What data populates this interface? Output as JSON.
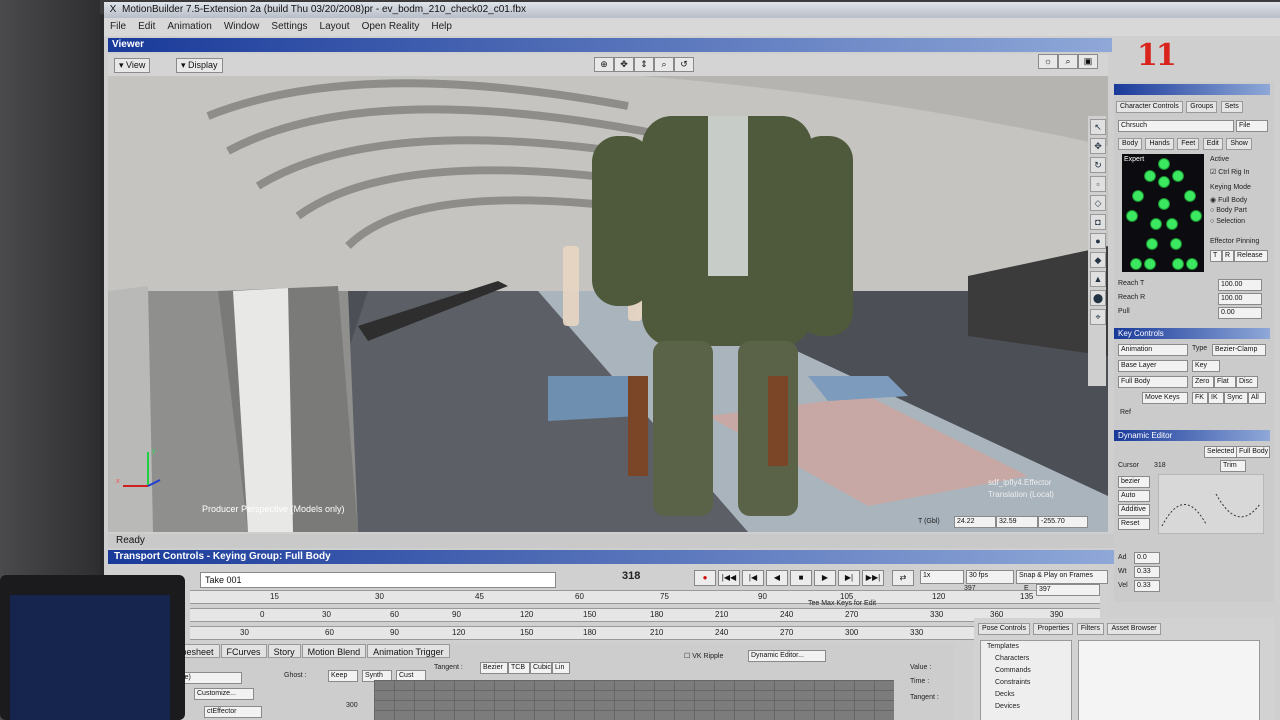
{
  "window": {
    "title": "MotionBuilder 7.5-Extension 2a  (build Thu 03/20/2008)pr  -  ev_bodm_210_check02_c01.fbx",
    "close_glyph": "X"
  },
  "menu": [
    "File",
    "Edit",
    "Animation",
    "Window",
    "Settings",
    "Layout",
    "Open Reality",
    "Help"
  ],
  "viewer": {
    "title": "Viewer",
    "view_label": "View",
    "display_label": "Display",
    "camera_label": "Producer Perspective (Models only)",
    "effector_label": "sdf_lpfly4.Effector",
    "translation_label": "Translation (Local)",
    "status": "Ready",
    "coords": {
      "t_label": "T (Gbl)",
      "x": "24.22",
      "y": "32.59",
      "z": "-255.70"
    },
    "axis_x": "x",
    "axis_y": "y"
  },
  "transport": {
    "title": "Transport Controls  -  Keying Group: Full Body",
    "take": "Take 001",
    "frame_counter": "318",
    "fps": "30 fps",
    "snap": "Snap & Play on Frames",
    "speed": "1x",
    "end_frame": "397",
    "end_label": "E",
    "end_value": "397",
    "ruler_top": [
      "15",
      "30",
      "45",
      "60",
      "75",
      "90",
      "105",
      "120",
      "135"
    ],
    "ruler_mid": [
      "0",
      "30",
      "60",
      "90",
      "120",
      "150",
      "180",
      "210",
      "240",
      "270",
      "330",
      "360",
      "390"
    ],
    "ruler_bottom": [
      "30",
      "60",
      "90",
      "120",
      "150",
      "180",
      "210",
      "240",
      "270",
      "300",
      "330",
      "360",
      "390"
    ],
    "hint": "Tee Max Keys for Edit"
  },
  "character_controls": {
    "tabs": [
      "Character Controls",
      "Groups",
      "Sets"
    ],
    "character": "Chrsuch",
    "file_label": "File",
    "body_tabs": [
      "Body",
      "Hands",
      "Feet"
    ],
    "edit_label": "Edit",
    "show_label": "Show",
    "expert_label": "Expert",
    "active_label": "Active",
    "ctrl_rig_label": "Ctrl Rig In",
    "keying_mode_label": "Keying Mode",
    "keying_modes": [
      "Full Body",
      "Body Part",
      "Selection"
    ],
    "effector_pinning": "Effector Pinning",
    "pin_t": "T",
    "pin_r": "R",
    "release_label": "Release",
    "reach_t_label": "Reach T",
    "reach_t_value": "100.00",
    "reach_r_label": "Reach R",
    "reach_r_value": "100.00",
    "pull_label": "Pull",
    "pull_value": "0.00"
  },
  "key_controls": {
    "title": "Key Controls",
    "mode": "Animation",
    "type_label": "Type",
    "type_value": "Bezier-Clamp",
    "layer": "Base Layer",
    "key_label": "Key",
    "body": "Full Body",
    "zero": "Zero",
    "flat": "Flat",
    "disc": "Disc",
    "move_keys": "Move Keys",
    "fk": "FK",
    "ik": "IK",
    "sync": "Sync",
    "all": "All",
    "ref_label": "Ref"
  },
  "dynamic_editor": {
    "title": "Dynamic Editor",
    "selected": "Selected",
    "full_body": "Full Body",
    "cursor_label": "Cursor",
    "cursor_value": "318",
    "trim": "Trim",
    "curve": "bezier",
    "mode": "Auto",
    "additive": "Additive",
    "reset": "Reset",
    "rows": [
      {
        "label": "Ad",
        "value": "0.0"
      },
      {
        "label": "Wt",
        "value": "0.33"
      },
      {
        "label": "Vel",
        "value": "0.33"
      }
    ]
  },
  "bottom": {
    "tabs": [
      "Dopesheet",
      "FCurves",
      "Story",
      "Motion Blend",
      "Animation Trigger"
    ],
    "type_label": "(Type)",
    "customize": "Customize...",
    "effector": "ctEffector",
    "ghost_label": "Ghost :",
    "keep": "Keep",
    "sync": "Synth",
    "cust": "Cust",
    "tangent_label": "Tangent :",
    "tangent_opts": [
      "Bezier",
      "TCB",
      "Cubic",
      "Lin"
    ],
    "vk_ripple": "VK Ripple",
    "dynamic_editor_btn": "Dynamic Editor...",
    "value_label": "Value :",
    "time_label": "Time :",
    "tangent2_label": "Tangent :",
    "y_tick": "300"
  },
  "assets": {
    "tabs": [
      "Pose Controls",
      "Properties",
      "Filters",
      "Asset Browser"
    ],
    "tree": [
      "Templates",
      "Characters",
      "Commands",
      "Constraints",
      "Decks",
      "Devices"
    ]
  },
  "logo_text": "11"
}
